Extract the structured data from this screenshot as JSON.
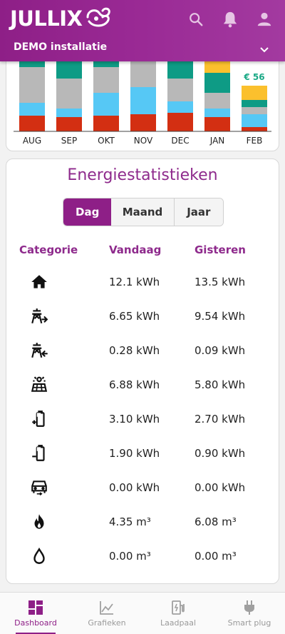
{
  "app": {
    "logo_text": "JULLIX",
    "installation": "DEMO installatie"
  },
  "chart_data": {
    "type": "bar",
    "stacked": true,
    "categories": [
      "AUG",
      "SEP",
      "OKT",
      "NOV",
      "DEC",
      "JAN",
      "FEB"
    ],
    "annotation": {
      "category": "FEB",
      "text": "€ 56"
    },
    "colors": {
      "red": "#d32f12",
      "blue": "#56c8f5",
      "grey": "#b8b8b8",
      "teal": "#0e9b85",
      "yellow": "#fbc02d"
    },
    "bars": [
      {
        "category": "AUG",
        "segments": [
          [
            "red",
            22
          ],
          [
            "blue",
            18
          ],
          [
            "grey",
            50
          ],
          [
            "teal",
            8
          ]
        ]
      },
      {
        "category": "SEP",
        "segments": [
          [
            "red",
            20
          ],
          [
            "blue",
            12
          ],
          [
            "grey",
            42
          ],
          [
            "teal",
            24
          ]
        ]
      },
      {
        "category": "OKT",
        "segments": [
          [
            "red",
            22
          ],
          [
            "blue",
            32
          ],
          [
            "grey",
            36
          ],
          [
            "teal",
            10
          ]
        ]
      },
      {
        "category": "NOV",
        "segments": [
          [
            "red",
            24
          ],
          [
            "blue",
            38
          ],
          [
            "grey",
            44
          ]
        ]
      },
      {
        "category": "DEC",
        "segments": [
          [
            "red",
            26
          ],
          [
            "blue",
            16
          ],
          [
            "grey",
            32
          ],
          [
            "teal",
            28
          ]
        ]
      },
      {
        "category": "JAN",
        "segments": [
          [
            "red",
            20
          ],
          [
            "blue",
            12
          ],
          [
            "grey",
            22
          ],
          [
            "teal",
            28
          ],
          [
            "yellow",
            18
          ]
        ]
      },
      {
        "category": "FEB",
        "segments": [
          [
            "red",
            6
          ],
          [
            "blue",
            18
          ],
          [
            "grey",
            10
          ],
          [
            "teal",
            10
          ],
          [
            "yellow",
            20
          ]
        ]
      }
    ]
  },
  "stats": {
    "title": "Energiestatistieken",
    "tabs": [
      "Dag",
      "Maand",
      "Jaar"
    ],
    "active_tab": "Dag",
    "headers": {
      "category": "Categorie",
      "today": "Vandaag",
      "yesterday": "Gisteren"
    },
    "rows": [
      {
        "icon": "home-icon",
        "today": "12.1 kWh",
        "yesterday": "13.5 kWh"
      },
      {
        "icon": "grid-import-icon",
        "today": "6.65 kWh",
        "yesterday": "9.54 kWh"
      },
      {
        "icon": "grid-export-icon",
        "today": "0.28 kWh",
        "yesterday": "0.09 kWh"
      },
      {
        "icon": "solar-panel-icon",
        "today": "6.88 kWh",
        "yesterday": "5.80 kWh"
      },
      {
        "icon": "battery-charge-icon",
        "today": "3.10 kWh",
        "yesterday": "2.70 kWh"
      },
      {
        "icon": "battery-discharge-icon",
        "today": "1.90 kWh",
        "yesterday": "0.90 kWh"
      },
      {
        "icon": "ev-car-icon",
        "today": "0.00 kWh",
        "yesterday": "0.00 kWh"
      },
      {
        "icon": "gas-flame-icon",
        "today": "4.35 m³",
        "yesterday": "6.08 m³"
      },
      {
        "icon": "water-drop-icon",
        "today": "0.00 m³",
        "yesterday": "0.00 m³"
      }
    ]
  },
  "nav": [
    {
      "label": "Dashboard",
      "icon": "dashboard-icon",
      "active": true
    },
    {
      "label": "Grafieken",
      "icon": "chart-line-icon",
      "active": false
    },
    {
      "label": "Laadpaal",
      "icon": "ev-charger-icon",
      "active": false
    },
    {
      "label": "Smart plug",
      "icon": "plug-icon",
      "active": false
    }
  ],
  "colors": {
    "brand": "#8e1f87",
    "heading": "#8e2a8c",
    "annotation": "#1aa986"
  }
}
